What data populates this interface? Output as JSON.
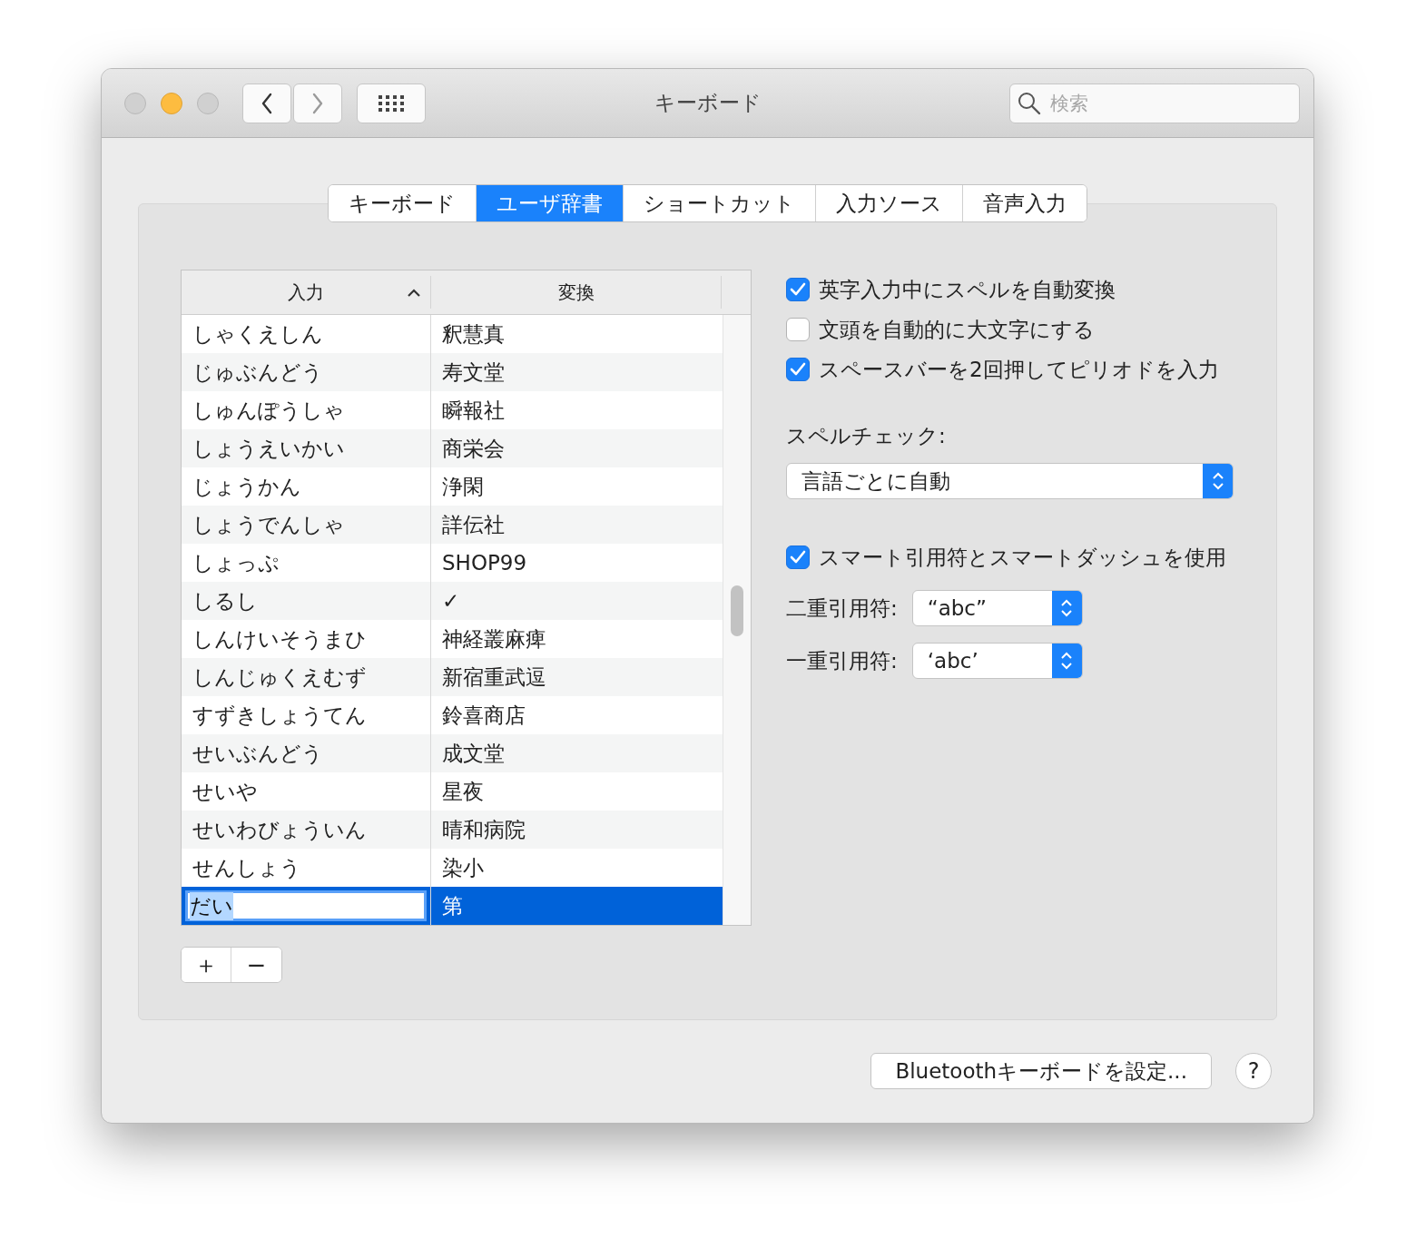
{
  "window": {
    "title": "キーボード"
  },
  "nav": [
    {
      "kind": "back",
      "disabled": false
    },
    {
      "kind": "forward",
      "disabled": true
    }
  ],
  "search": {
    "placeholder": "検索"
  },
  "tabs": [
    {
      "label": "キーボード",
      "selected": false
    },
    {
      "label": "ユーザ辞書",
      "selected": true
    },
    {
      "label": "ショートカット",
      "selected": false
    },
    {
      "label": "入力ソース",
      "selected": false
    },
    {
      "label": "音声入力",
      "selected": false
    }
  ],
  "dictionary": {
    "columns": [
      {
        "label": "入力",
        "sorted": true
      },
      {
        "label": "変換",
        "sorted": false
      }
    ],
    "rows": [
      {
        "input": "しゃくえしん",
        "conversion": "釈慧真",
        "selected": false,
        "editing": false
      },
      {
        "input": "じゅぶんどう",
        "conversion": "寿文堂",
        "selected": false,
        "editing": false
      },
      {
        "input": "しゅんぽうしゃ",
        "conversion": "瞬報社",
        "selected": false,
        "editing": false
      },
      {
        "input": "しょうえいかい",
        "conversion": "商栄会",
        "selected": false,
        "editing": false
      },
      {
        "input": "じょうかん",
        "conversion": "浄閑",
        "selected": false,
        "editing": false
      },
      {
        "input": "しょうでんしゃ",
        "conversion": "詳伝社",
        "selected": false,
        "editing": false
      },
      {
        "input": "しょっぷ",
        "conversion": "SHOP99",
        "selected": false,
        "editing": false
      },
      {
        "input": "しるし",
        "conversion": "✓",
        "selected": false,
        "editing": false
      },
      {
        "input": "しんけいそうまひ",
        "conversion": "神経叢麻痺",
        "selected": false,
        "editing": false
      },
      {
        "input": "しんじゅくえむず",
        "conversion": "新宿重武逗",
        "selected": false,
        "editing": false
      },
      {
        "input": "すずきしょうてん",
        "conversion": "鈴喜商店",
        "selected": false,
        "editing": false
      },
      {
        "input": "せいぶんどう",
        "conversion": "成文堂",
        "selected": false,
        "editing": false
      },
      {
        "input": "せいや",
        "conversion": "星夜",
        "selected": false,
        "editing": false
      },
      {
        "input": "せいわびょういん",
        "conversion": "晴和病院",
        "selected": false,
        "editing": false
      },
      {
        "input": "せんしょう",
        "conversion": "染小",
        "selected": false,
        "editing": false
      },
      {
        "input": "だい",
        "conversion": "第",
        "selected": true,
        "editing": true
      }
    ]
  },
  "edit_buttons": [
    "＋",
    "−"
  ],
  "options": [
    {
      "label": "英字入力中にスペルを自動変換",
      "checked": true
    },
    {
      "label": "文頭を自動的に大文字にする",
      "checked": false
    },
    {
      "label": "スペースバーを2回押してピリオドを入力",
      "checked": true
    }
  ],
  "spell_check": {
    "label": "スペルチェック:",
    "value": "言語ごとに自動"
  },
  "smart_quotes": {
    "label": "スマート引用符とスマートダッシュを使用",
    "checked": true
  },
  "quote_popups": [
    {
      "label": "二重引用符:",
      "value": "“abc”"
    },
    {
      "label": "一重引用符:",
      "value": "‘abc’"
    }
  ],
  "bluetooth_button": "Bluetoothキーボードを設定...",
  "help_button": "?"
}
